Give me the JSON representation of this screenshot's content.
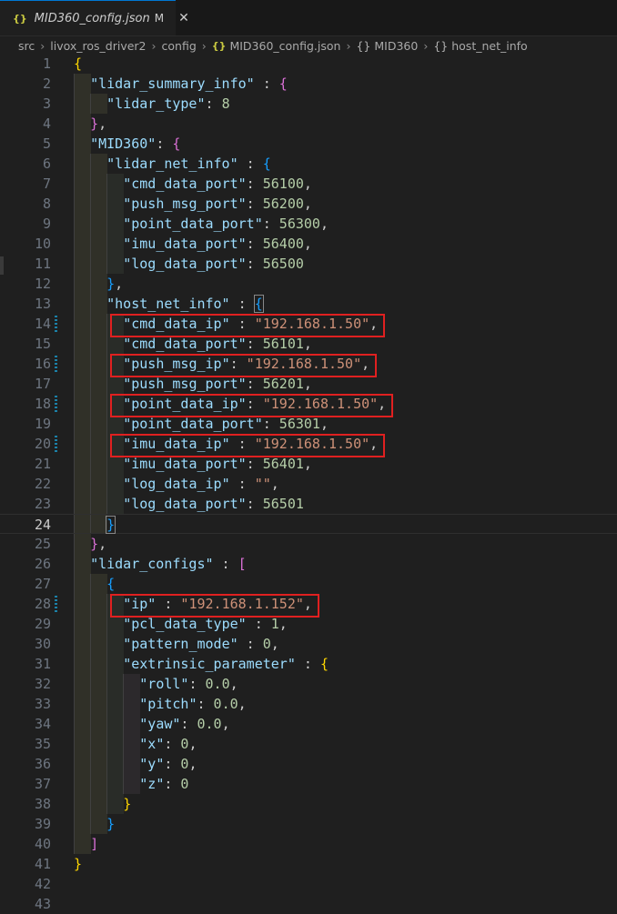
{
  "tab": {
    "icon": "{}",
    "title": "MID360_config.json",
    "modified": "M",
    "close": "✕"
  },
  "breadcrumb": {
    "items": [
      "src",
      "livox_ros_driver2",
      "config"
    ],
    "file_icon": "{}",
    "file": "MID360_config.json",
    "symbols": [
      "MID360",
      "host_net_info"
    ],
    "symbol_icon": "{}",
    "separator": "›"
  },
  "editor": {
    "current_line": 24,
    "modified_lines": [
      14,
      16,
      18,
      20,
      28
    ],
    "highlighted_lines": [
      14,
      16,
      18,
      20,
      28
    ],
    "lines": [
      {
        "n": "1",
        "indent": 0,
        "tokens": [
          [
            "b1",
            "{"
          ]
        ]
      },
      {
        "n": "2",
        "indent": 1,
        "tokens": [
          [
            "k",
            "\"lidar_summary_info\""
          ],
          [
            "p",
            " : "
          ],
          [
            "b2",
            "{"
          ]
        ]
      },
      {
        "n": "3",
        "indent": 2,
        "tokens": [
          [
            "k",
            "\"lidar_type\""
          ],
          [
            "p",
            ": "
          ],
          [
            "n",
            "8"
          ]
        ]
      },
      {
        "n": "4",
        "indent": 1,
        "tokens": [
          [
            "b2",
            "}"
          ],
          [
            "p",
            ","
          ]
        ]
      },
      {
        "n": "5",
        "indent": 1,
        "tokens": [
          [
            "k",
            "\"MID360\""
          ],
          [
            "p",
            ": "
          ],
          [
            "b2",
            "{"
          ]
        ]
      },
      {
        "n": "6",
        "indent": 2,
        "tokens": [
          [
            "k",
            "\"lidar_net_info\""
          ],
          [
            "p",
            " : "
          ],
          [
            "b3",
            "{"
          ]
        ]
      },
      {
        "n": "7",
        "indent": 3,
        "tokens": [
          [
            "k",
            "\"cmd_data_port\""
          ],
          [
            "p",
            ": "
          ],
          [
            "n",
            "56100"
          ],
          [
            "p",
            ","
          ]
        ]
      },
      {
        "n": "8",
        "indent": 3,
        "tokens": [
          [
            "k",
            "\"push_msg_port\""
          ],
          [
            "p",
            ": "
          ],
          [
            "n",
            "56200"
          ],
          [
            "p",
            ","
          ]
        ]
      },
      {
        "n": "9",
        "indent": 3,
        "tokens": [
          [
            "k",
            "\"point_data_port\""
          ],
          [
            "p",
            ": "
          ],
          [
            "n",
            "56300"
          ],
          [
            "p",
            ","
          ]
        ]
      },
      {
        "n": "10",
        "indent": 3,
        "tokens": [
          [
            "k",
            "\"imu_data_port\""
          ],
          [
            "p",
            ": "
          ],
          [
            "n",
            "56400"
          ],
          [
            "p",
            ","
          ]
        ]
      },
      {
        "n": "11",
        "indent": 3,
        "tokens": [
          [
            "k",
            "\"log_data_port\""
          ],
          [
            "p",
            ": "
          ],
          [
            "n",
            "56500"
          ]
        ]
      },
      {
        "n": "12",
        "indent": 2,
        "tokens": [
          [
            "b3",
            "}"
          ],
          [
            "p",
            ","
          ]
        ]
      },
      {
        "n": "13",
        "indent": 2,
        "tokens": [
          [
            "k",
            "\"host_net_info\""
          ],
          [
            "p",
            " : "
          ],
          [
            "b3 bm",
            "{"
          ]
        ]
      },
      {
        "n": "14",
        "indent": 3,
        "tokens": [
          [
            "k",
            "\"cmd_data_ip\""
          ],
          [
            "p",
            " : "
          ],
          [
            "s",
            "\"192.168.1.50\""
          ],
          [
            "p",
            ","
          ]
        ]
      },
      {
        "n": "15",
        "indent": 3,
        "tokens": [
          [
            "k",
            "\"cmd_data_port\""
          ],
          [
            "p",
            ": "
          ],
          [
            "n",
            "56101"
          ],
          [
            "p",
            ","
          ]
        ]
      },
      {
        "n": "16",
        "indent": 3,
        "tokens": [
          [
            "k",
            "\"push_msg_ip\""
          ],
          [
            "p",
            ": "
          ],
          [
            "s",
            "\"192.168.1.50\""
          ],
          [
            "p",
            ","
          ]
        ]
      },
      {
        "n": "17",
        "indent": 3,
        "tokens": [
          [
            "k",
            "\"push_msg_port\""
          ],
          [
            "p",
            ": "
          ],
          [
            "n",
            "56201"
          ],
          [
            "p",
            ","
          ]
        ]
      },
      {
        "n": "18",
        "indent": 3,
        "tokens": [
          [
            "k",
            "\"point_data_ip\""
          ],
          [
            "p",
            ": "
          ],
          [
            "s",
            "\"192.168.1.50\""
          ],
          [
            "p",
            ","
          ]
        ]
      },
      {
        "n": "19",
        "indent": 3,
        "tokens": [
          [
            "k",
            "\"point_data_port\""
          ],
          [
            "p",
            ": "
          ],
          [
            "n",
            "56301"
          ],
          [
            "p",
            ","
          ]
        ]
      },
      {
        "n": "20",
        "indent": 3,
        "tokens": [
          [
            "k",
            "\"imu_data_ip\""
          ],
          [
            "p",
            " : "
          ],
          [
            "s",
            "\"192.168.1.50\""
          ],
          [
            "p",
            ","
          ]
        ]
      },
      {
        "n": "21",
        "indent": 3,
        "tokens": [
          [
            "k",
            "\"imu_data_port\""
          ],
          [
            "p",
            ": "
          ],
          [
            "n",
            "56401"
          ],
          [
            "p",
            ","
          ]
        ]
      },
      {
        "n": "22",
        "indent": 3,
        "tokens": [
          [
            "k",
            "\"log_data_ip\""
          ],
          [
            "p",
            " : "
          ],
          [
            "s",
            "\"\""
          ],
          [
            "p",
            ","
          ]
        ]
      },
      {
        "n": "23",
        "indent": 3,
        "tokens": [
          [
            "k",
            "\"log_data_port\""
          ],
          [
            "p",
            ": "
          ],
          [
            "n",
            "56501"
          ]
        ]
      },
      {
        "n": "24",
        "indent": 2,
        "tokens": [
          [
            "b3 bm",
            "}"
          ]
        ]
      },
      {
        "n": "25",
        "indent": 1,
        "tokens": [
          [
            "b2",
            "}"
          ],
          [
            "p",
            ","
          ]
        ]
      },
      {
        "n": "26",
        "indent": 1,
        "tokens": [
          [
            "k",
            "\"lidar_configs\""
          ],
          [
            "p",
            " : "
          ],
          [
            "b2",
            "["
          ]
        ]
      },
      {
        "n": "27",
        "indent": 2,
        "tokens": [
          [
            "b3",
            "{"
          ]
        ]
      },
      {
        "n": "28",
        "indent": 3,
        "tokens": [
          [
            "k",
            "\"ip\""
          ],
          [
            "p",
            " : "
          ],
          [
            "s",
            "\"192.168.1.152\""
          ],
          [
            "p",
            ","
          ]
        ]
      },
      {
        "n": "29",
        "indent": 3,
        "tokens": [
          [
            "k",
            "\"pcl_data_type\""
          ],
          [
            "p",
            " : "
          ],
          [
            "n",
            "1"
          ],
          [
            "p",
            ","
          ]
        ]
      },
      {
        "n": "30",
        "indent": 3,
        "tokens": [
          [
            "k",
            "\"pattern_mode\""
          ],
          [
            "p",
            " : "
          ],
          [
            "n",
            "0"
          ],
          [
            "p",
            ","
          ]
        ]
      },
      {
        "n": "31",
        "indent": 3,
        "tokens": [
          [
            "k",
            "\"extrinsic_parameter\""
          ],
          [
            "p",
            " : "
          ],
          [
            "b1",
            "{"
          ]
        ]
      },
      {
        "n": "32",
        "indent": 4,
        "tokens": [
          [
            "k",
            "\"roll\""
          ],
          [
            "p",
            ": "
          ],
          [
            "n",
            "0.0"
          ],
          [
            "p",
            ","
          ]
        ]
      },
      {
        "n": "33",
        "indent": 4,
        "tokens": [
          [
            "k",
            "\"pitch\""
          ],
          [
            "p",
            ": "
          ],
          [
            "n",
            "0.0"
          ],
          [
            "p",
            ","
          ]
        ]
      },
      {
        "n": "34",
        "indent": 4,
        "tokens": [
          [
            "k",
            "\"yaw\""
          ],
          [
            "p",
            ": "
          ],
          [
            "n",
            "0.0"
          ],
          [
            "p",
            ","
          ]
        ]
      },
      {
        "n": "35",
        "indent": 4,
        "tokens": [
          [
            "k",
            "\"x\""
          ],
          [
            "p",
            ": "
          ],
          [
            "n",
            "0"
          ],
          [
            "p",
            ","
          ]
        ]
      },
      {
        "n": "36",
        "indent": 4,
        "tokens": [
          [
            "k",
            "\"y\""
          ],
          [
            "p",
            ": "
          ],
          [
            "n",
            "0"
          ],
          [
            "p",
            ","
          ]
        ]
      },
      {
        "n": "37",
        "indent": 4,
        "tokens": [
          [
            "k",
            "\"z\""
          ],
          [
            "p",
            ": "
          ],
          [
            "n",
            "0"
          ]
        ]
      },
      {
        "n": "38",
        "indent": 3,
        "tokens": [
          [
            "b1",
            "}"
          ]
        ]
      },
      {
        "n": "39",
        "indent": 2,
        "tokens": [
          [
            "b3",
            "}"
          ]
        ]
      },
      {
        "n": "40",
        "indent": 1,
        "tokens": [
          [
            "b2",
            "]"
          ]
        ]
      },
      {
        "n": "41",
        "indent": 0,
        "tokens": [
          [
            "b1",
            "}"
          ]
        ]
      },
      {
        "n": "42",
        "indent": 0,
        "tokens": []
      },
      {
        "n": "43",
        "indent": 0,
        "tokens": []
      }
    ]
  },
  "colors": {
    "highlight_box": "#e02020",
    "modified_gutter": "#1b81a8",
    "active_tab_border": "#0078d4"
  }
}
